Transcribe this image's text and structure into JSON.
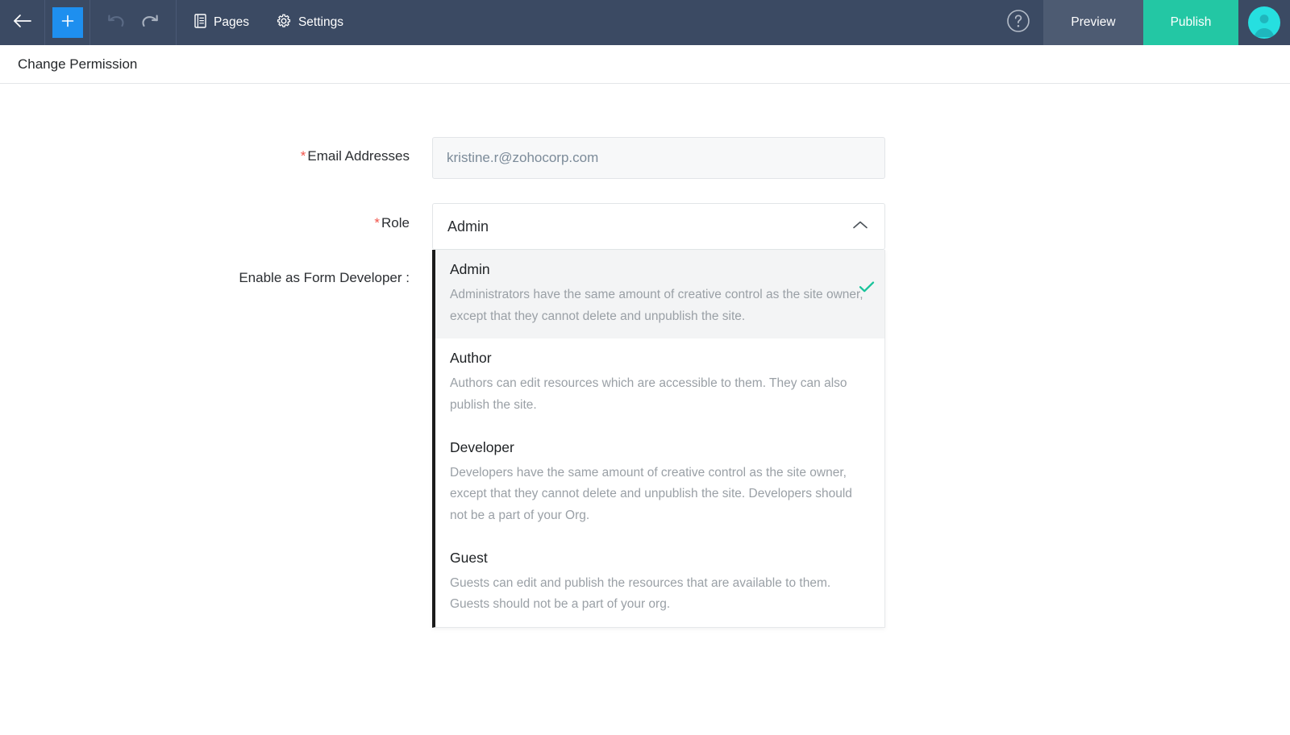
{
  "toolbar": {
    "back_icon": "arrow-left-icon",
    "add_icon": "plus-icon",
    "undo_icon": "undo-arrow-icon",
    "redo_icon": "redo-arrow-icon",
    "pages_label": "Pages",
    "pages_icon": "pages-document-icon",
    "settings_label": "Settings",
    "settings_icon": "gear-icon",
    "help_icon": "question-mark-circle-icon",
    "preview_label": "Preview",
    "publish_label": "Publish",
    "avatar_icon": "user-avatar-icon",
    "colors": {
      "bar_background": "#3b4a63",
      "add_button": "#1e8fef",
      "preview_background": "#4d5b72",
      "publish_background": "#23c7a4",
      "avatar_background": "#26dfe0"
    }
  },
  "header": {
    "title": "Change Permission"
  },
  "form": {
    "email": {
      "label": "Email Addresses",
      "required_marker": "*",
      "value": "kristine.r@zohocorp.com",
      "placeholder": "kristine.r@zohocorp.com"
    },
    "role": {
      "label": "Role",
      "required_marker": "*",
      "selected_value": "Admin",
      "chevron_icon": "chevron-up-icon",
      "expanded": true,
      "options": [
        {
          "name": "Admin",
          "description": "Administrators have the same amount of creative control as the site owner, except that they cannot delete and unpublish the site.",
          "selected": true,
          "check_icon": "check-icon",
          "check_color": "#18c39a"
        },
        {
          "name": "Author",
          "description": "Authors can edit resources which are accessible to them. They can also publish the site.",
          "selected": false
        },
        {
          "name": "Developer",
          "description": "Developers have the same amount of creative control as the site owner, except that they cannot delete and unpublish the site. Developers should not be a part of your Org.",
          "selected": false
        },
        {
          "name": "Guest",
          "description": "Guests can edit and publish the resources that are available to them. Guests should not be a part of your org.",
          "selected": false
        }
      ]
    },
    "form_developer": {
      "label": "Enable as Form Developer :"
    }
  }
}
